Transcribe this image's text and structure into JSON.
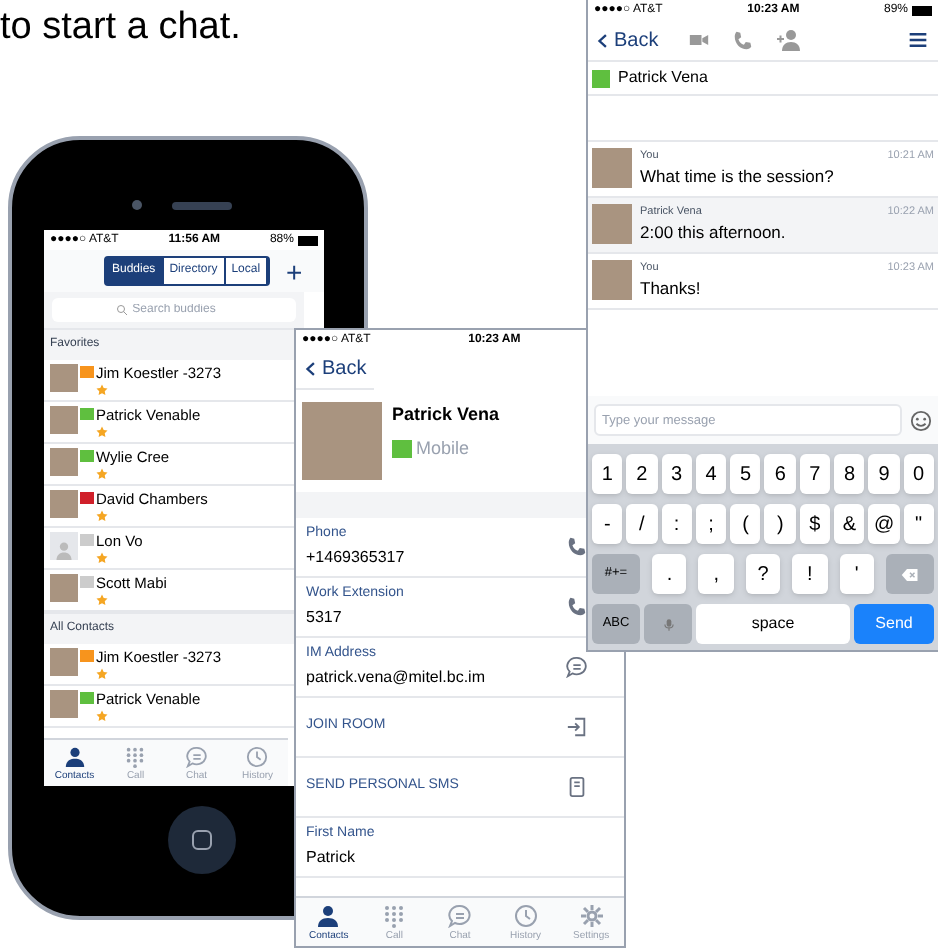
{
  "caption": "to start a chat.",
  "contacts_screen": {
    "status_bar": {
      "carrier": "●●●●○ AT&T",
      "time": "11:56 AM",
      "battery": "88%"
    },
    "segments": [
      {
        "label": "Buddies",
        "selected": true
      },
      {
        "label": "Directory",
        "selected": false
      },
      {
        "label": "Local",
        "selected": false
      }
    ],
    "add_button": "+",
    "search": {
      "placeholder": "Search buddies"
    },
    "sections": [
      {
        "title": "Favorites",
        "contacts": [
          {
            "name": "Jim Koestler -3273",
            "kind": "photo",
            "color": "#f7941d",
            "favorite": true
          },
          {
            "name": "Patrick Venable",
            "kind": "photo",
            "color": "#5fbf3f",
            "favorite": true
          },
          {
            "name": "Wylie Cree",
            "kind": "photo",
            "color": "#5fbf3f",
            "favorite": true
          },
          {
            "name": "David Chambers",
            "kind": "photo",
            "color": "#d0202a",
            "favorite": true
          },
          {
            "name": "Lon Vo",
            "kind": "silhouette",
            "color": "#cccccc",
            "favorite": true
          },
          {
            "name": "Scott Mabi",
            "kind": "photo",
            "color": "#cccccc",
            "favorite": true
          }
        ]
      },
      {
        "title": "All Contacts",
        "contacts": [
          {
            "name": "Jim Koestler -3273",
            "kind": "photo",
            "color": "#f7941d",
            "favorite": true
          },
          {
            "name": "Patrick Venable",
            "kind": "photo",
            "color": "#5fbf3f",
            "favorite": true
          }
        ]
      }
    ],
    "tab_bar": [
      {
        "label": "Contacts",
        "kind": "contacts",
        "selected": true
      },
      {
        "label": "Call",
        "kind": "call",
        "selected": false
      },
      {
        "label": "Chat",
        "kind": "chat",
        "selected": false
      },
      {
        "label": "History",
        "kind": "history",
        "selected": false
      }
    ]
  },
  "contact_screen": {
    "status_bar": {
      "carrier": "●●●●○ AT&T",
      "time": "10:23 AM"
    },
    "back": "Back",
    "name": "Patrick Vena",
    "presence": "Mobile",
    "details": [
      {
        "kind": "phone",
        "label": "Phone",
        "value": "+1469365317"
      },
      {
        "kind": "phone",
        "label": "Work Extension",
        "value": "5317"
      },
      {
        "kind": "im",
        "label": "IM Address",
        "value": "patrick.vena@mitel.bc.im"
      },
      {
        "kind": "join",
        "label": "JOIN ROOM"
      },
      {
        "kind": "sms",
        "label": "SEND PERSONAL SMS"
      },
      {
        "kind": "text",
        "label": "First Name",
        "value": "Patrick"
      }
    ],
    "tab_bar": [
      {
        "label": "Contacts",
        "kind": "contacts",
        "selected": true
      },
      {
        "label": "Call",
        "kind": "call",
        "selected": false
      },
      {
        "label": "Chat",
        "kind": "chat",
        "selected": false
      },
      {
        "label": "History",
        "kind": "history",
        "selected": false
      },
      {
        "label": "Settings",
        "kind": "settings",
        "selected": false
      }
    ]
  },
  "chat_screen": {
    "status_bar": {
      "carrier": "●●●●○ AT&T",
      "time": "10:23 AM",
      "battery": "89%"
    },
    "back": "Back",
    "contact": "Patrick Vena",
    "messages": [
      {
        "sender": "You",
        "text": "What time is the session?",
        "time": "10:21 AM",
        "incoming": false
      },
      {
        "sender": "Patrick Vena",
        "text": "2:00 this afternoon.",
        "time": "10:22 AM",
        "incoming": true
      },
      {
        "sender": "You",
        "text": "Thanks!",
        "time": "10:23 AM",
        "incoming": false
      }
    ],
    "input": {
      "placeholder": "Type your message"
    },
    "keyboard": [
      [
        {
          "kind": "char",
          "label": "1"
        },
        {
          "kind": "char",
          "label": "2"
        },
        {
          "kind": "char",
          "label": "3"
        },
        {
          "kind": "char",
          "label": "4"
        },
        {
          "kind": "char",
          "label": "5"
        },
        {
          "kind": "char",
          "label": "6"
        },
        {
          "kind": "char",
          "label": "7"
        },
        {
          "kind": "char",
          "label": "8"
        },
        {
          "kind": "char",
          "label": "9"
        },
        {
          "kind": "char",
          "label": "0"
        }
      ],
      [
        {
          "kind": "char",
          "label": "-"
        },
        {
          "kind": "char",
          "label": "/"
        },
        {
          "kind": "char",
          "label": ":"
        },
        {
          "kind": "char",
          "label": ";"
        },
        {
          "kind": "char",
          "label": "("
        },
        {
          "kind": "char",
          "label": ")"
        },
        {
          "kind": "char",
          "label": "$"
        },
        {
          "kind": "char",
          "label": "&"
        },
        {
          "kind": "char",
          "label": "@"
        },
        {
          "kind": "char",
          "label": "\""
        }
      ],
      [
        {
          "kind": "mod",
          "label": "#+="
        },
        {
          "kind": "char",
          "label": "."
        },
        {
          "kind": "char",
          "label": ","
        },
        {
          "kind": "char",
          "label": "?"
        },
        {
          "kind": "char",
          "label": "!"
        },
        {
          "kind": "char",
          "label": "'"
        },
        {
          "kind": "backspace"
        }
      ],
      [
        {
          "kind": "mod",
          "label": "ABC"
        },
        {
          "kind": "mic"
        },
        {
          "kind": "space",
          "label": "space"
        },
        {
          "kind": "send",
          "label": "Send"
        }
      ]
    ]
  }
}
